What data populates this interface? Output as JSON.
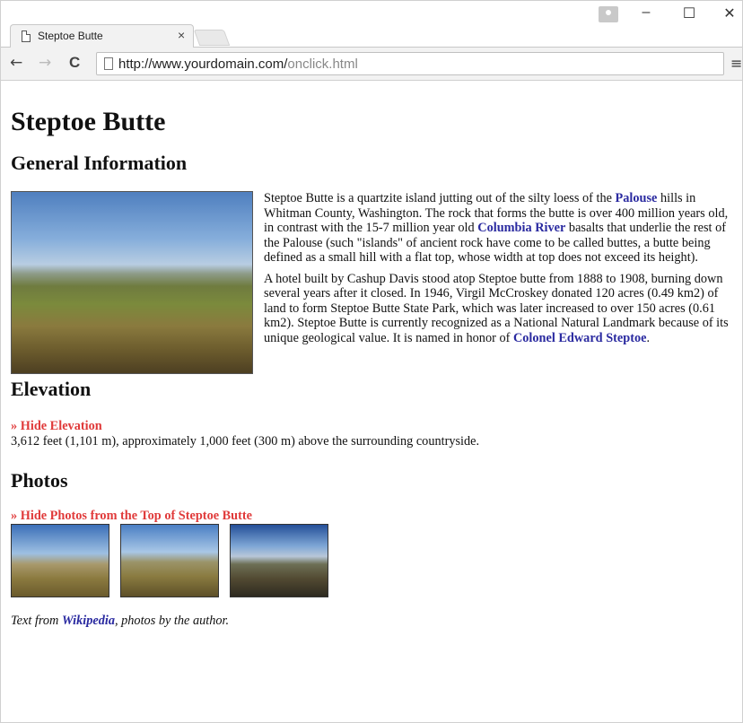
{
  "browser": {
    "tab_title": "Steptoe Butte",
    "tab_close": "×",
    "url_host": "http://www.yourdomain.com/",
    "url_path": "onclick.html",
    "window_controls": {
      "minimize": "–",
      "maximize": "☐",
      "close": "✕"
    },
    "nav": {
      "back": "←",
      "forward": "→",
      "reload": "C",
      "menu": "≡"
    }
  },
  "page": {
    "title": "Steptoe Butte",
    "general_heading": "General Information",
    "intro_p1": {
      "t1": "Steptoe Butte is a quartzite island jutting out of the silty loess of the ",
      "link1": "Palouse",
      "t2": " hills in Whitman County, Washington. The rock that forms the butte is over 400 million years old, in contrast with the 15-7 million year old ",
      "link2": "Columbia River",
      "t3": " basalts that underlie the rest of the Palouse (such \"islands\" of ancient rock have come to be called buttes, a butte being defined as a small hill with a flat top, whose width at top does not exceed its height)."
    },
    "intro_p2": {
      "t1": "A hotel built by Cashup Davis stood atop Steptoe butte from 1888 to 1908, burning down several years after it closed. In 1946, Virgil McCroskey donated 120 acres (0.49 km2) of land to form Steptoe Butte State Park, which was later increased to over 150 acres (0.61 km2). Steptoe Butte is currently recognized as a National Natural Landmark because of its unique geological value. It is named in honor of ",
      "link": "Colonel Edward Steptoe",
      "t2": "."
    },
    "elevation_heading": "Elevation",
    "elevation_toggle": "» Hide Elevation",
    "elevation_text": "3,612 feet (1,101 m), approximately 1,000 feet (300 m) above the surrounding countryside.",
    "photos_heading": "Photos",
    "photos_toggle": "» Hide Photos from the Top of Steptoe Butte",
    "credit": {
      "t1": "Text from ",
      "link": "Wikipedia",
      "t2": ", photos by the author."
    }
  }
}
